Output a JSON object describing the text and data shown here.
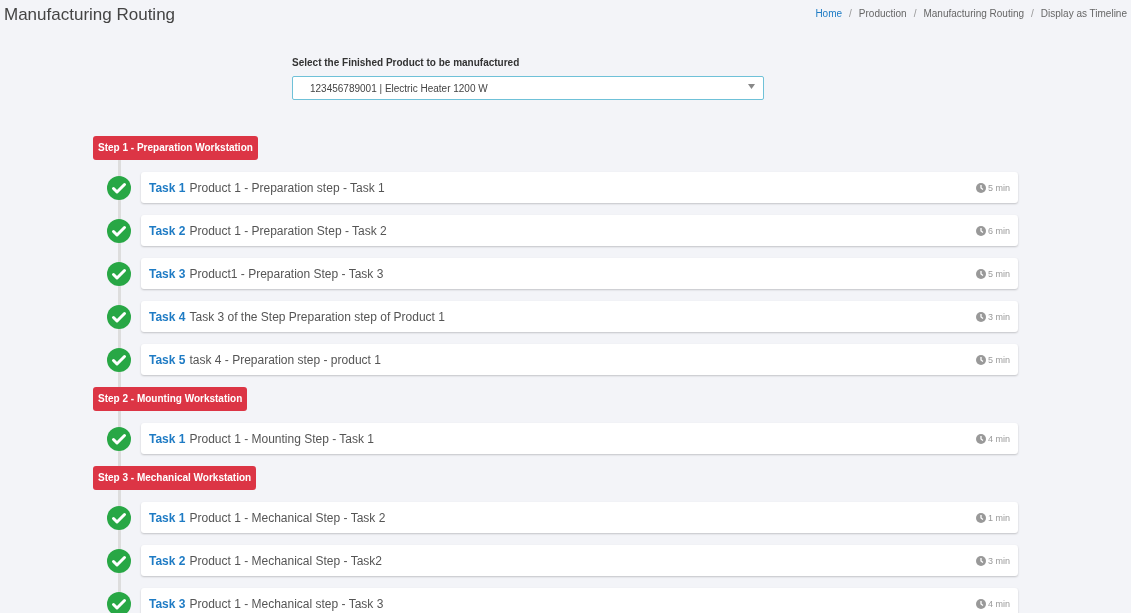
{
  "page_title": "Manufacturing Routing",
  "breadcrumb_separator": "/",
  "breadcrumb": [
    {
      "label": "Home",
      "link": true
    },
    {
      "label": "Production",
      "link": false
    },
    {
      "label": "Manufacturing Routing",
      "link": false
    },
    {
      "label": "Display as Timeline",
      "link": false
    }
  ],
  "product_select": {
    "label": "Select the Finished Product to be manufactured",
    "value": "123456789001 | Electric Heater 1200 W"
  },
  "steps": [
    {
      "label": "Step 1 - Preparation Workstation",
      "tasks": [
        {
          "name": "Task 1",
          "description": "Product 1 - Preparation step - Task 1",
          "duration": "5 min",
          "done": true
        },
        {
          "name": "Task 2",
          "description": "Product 1 - Preparation Step - Task 2",
          "duration": "6 min",
          "done": true
        },
        {
          "name": "Task 3",
          "description": "Product1 - Preparation Step - Task 3",
          "duration": "5 min",
          "done": true
        },
        {
          "name": "Task 4",
          "description": "Task 3 of the Step Preparation step of Product 1",
          "duration": "3 min",
          "done": true
        },
        {
          "name": "Task 5",
          "description": "task 4 - Preparation step - product 1",
          "duration": "5 min",
          "done": true
        }
      ]
    },
    {
      "label": "Step 2 - Mounting Workstation",
      "tasks": [
        {
          "name": "Task 1",
          "description": "Product 1 - Mounting Step - Task 1",
          "duration": "4 min",
          "done": true
        }
      ]
    },
    {
      "label": "Step 3 - Mechanical Workstation",
      "tasks": [
        {
          "name": "Task 1",
          "description": "Product 1 - Mechanical Step - Task 2",
          "duration": "1 min",
          "done": true
        },
        {
          "name": "Task 2",
          "description": "Product 1 - Mechanical Step - Task2",
          "duration": "3 min",
          "done": true
        },
        {
          "name": "Task 3",
          "description": "Product 1 - Mechanical step - Task 3",
          "duration": "4 min",
          "done": true
        }
      ]
    }
  ]
}
